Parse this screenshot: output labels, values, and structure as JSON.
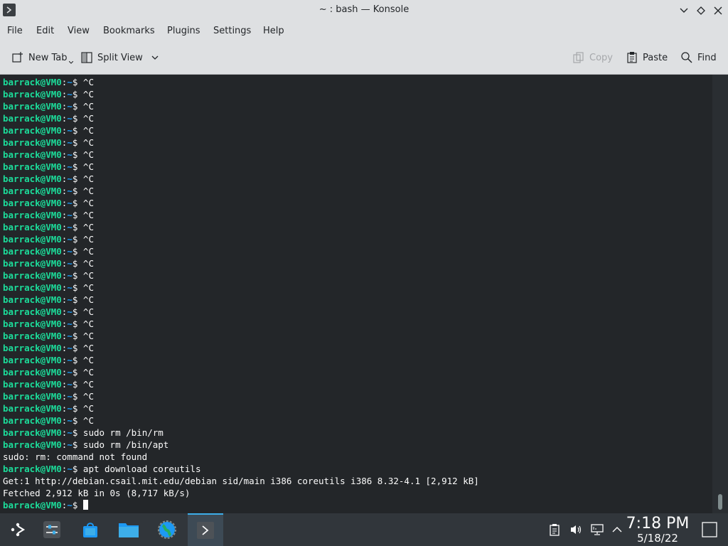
{
  "window": {
    "title": "~ : bash — Konsole"
  },
  "menu": [
    "File",
    "Edit",
    "View",
    "Bookmarks",
    "Plugins",
    "Settings",
    "Help"
  ],
  "toolbar": {
    "new_tab": "New Tab",
    "split_view": "Split View",
    "copy": "Copy",
    "paste": "Paste",
    "find": "Find"
  },
  "terminal": {
    "user_host": "barrack@VM0",
    "path": "~",
    "lines": [
      {
        "prompt": true,
        "cmd": " ^C"
      },
      {
        "prompt": true,
        "cmd": " ^C"
      },
      {
        "prompt": true,
        "cmd": " ^C"
      },
      {
        "prompt": true,
        "cmd": " ^C"
      },
      {
        "prompt": true,
        "cmd": " ^C"
      },
      {
        "prompt": true,
        "cmd": " ^C"
      },
      {
        "prompt": true,
        "cmd": " ^C"
      },
      {
        "prompt": true,
        "cmd": " ^C"
      },
      {
        "prompt": true,
        "cmd": " ^C"
      },
      {
        "prompt": true,
        "cmd": " ^C"
      },
      {
        "prompt": true,
        "cmd": " ^C"
      },
      {
        "prompt": true,
        "cmd": " ^C"
      },
      {
        "prompt": true,
        "cmd": " ^C"
      },
      {
        "prompt": true,
        "cmd": " ^C"
      },
      {
        "prompt": true,
        "cmd": " ^C"
      },
      {
        "prompt": true,
        "cmd": " ^C"
      },
      {
        "prompt": true,
        "cmd": " ^C"
      },
      {
        "prompt": true,
        "cmd": " ^C"
      },
      {
        "prompt": true,
        "cmd": " ^C"
      },
      {
        "prompt": true,
        "cmd": " ^C"
      },
      {
        "prompt": true,
        "cmd": " ^C"
      },
      {
        "prompt": true,
        "cmd": " ^C"
      },
      {
        "prompt": true,
        "cmd": " ^C"
      },
      {
        "prompt": true,
        "cmd": " ^C"
      },
      {
        "prompt": true,
        "cmd": " ^C"
      },
      {
        "prompt": true,
        "cmd": " ^C"
      },
      {
        "prompt": true,
        "cmd": " ^C"
      },
      {
        "prompt": true,
        "cmd": " ^C"
      },
      {
        "prompt": true,
        "cmd": " ^C"
      },
      {
        "prompt": true,
        "cmd": " sudo rm /bin/rm"
      },
      {
        "prompt": true,
        "cmd": " sudo rm /bin/apt"
      },
      {
        "prompt": false,
        "text": "sudo: rm: command not found"
      },
      {
        "prompt": true,
        "cmd": " apt download coreutils"
      },
      {
        "prompt": false,
        "text": "Get:1 http://debian.csail.mit.edu/debian sid/main i386 coreutils i386 8.32-4.1 [2,912 kB]"
      },
      {
        "prompt": false,
        "text": "Fetched 2,912 kB in 0s (8,717 kB/s)"
      },
      {
        "prompt": true,
        "cmd": " ",
        "cursor": true
      }
    ]
  },
  "clock": {
    "time": "7:18 PM",
    "date": "5/18/22"
  },
  "taskbar": {
    "tasks": [
      {
        "name": "application-launcher-icon"
      },
      {
        "name": "system-settings-icon"
      },
      {
        "name": "discover-store-icon"
      },
      {
        "name": "dolphin-file-manager-icon"
      },
      {
        "name": "web-browser-icon"
      },
      {
        "name": "konsole-terminal-icon"
      }
    ],
    "tray": [
      "clipboard-icon",
      "volume-icon",
      "network-icon",
      "expand-tray-icon"
    ]
  },
  "colors": {
    "prompt_user": "#1cdc9a",
    "prompt_path": "#1d99f3",
    "accent": "#3daee9"
  }
}
